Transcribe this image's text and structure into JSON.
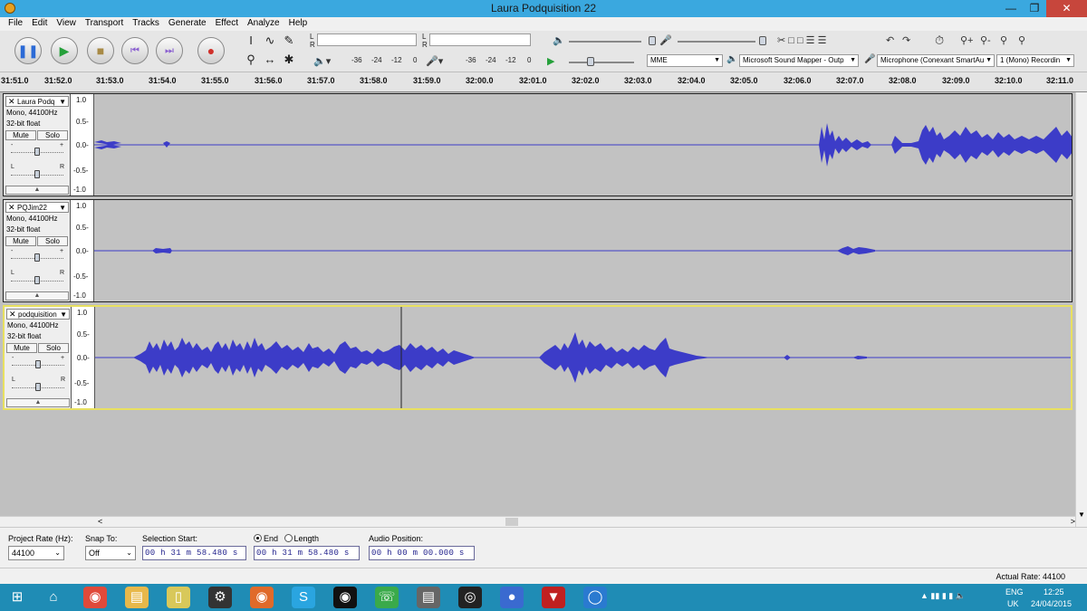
{
  "window": {
    "title": "Laura Podquisition 22"
  },
  "menu": [
    "File",
    "Edit",
    "View",
    "Transport",
    "Tracks",
    "Generate",
    "Effect",
    "Analyze",
    "Help"
  ],
  "meters": {
    "rec_scale": [
      "-36",
      "-24",
      "-12",
      "0"
    ],
    "play_scale": [
      "-36",
      "-24",
      "-12",
      "0"
    ],
    "lr": [
      "L",
      "R"
    ]
  },
  "devices": {
    "host": "MME",
    "output": "Microsoft Sound Mapper - Outp",
    "input": "Microphone (Conexant SmartAu",
    "channels": "1 (Mono) Recordin"
  },
  "ruler_ticks": [
    "31:51.0",
    "31:52.0",
    "31:53.0",
    "31:54.0",
    "31:55.0",
    "31:56.0",
    "31:57.0",
    "31:58.0",
    "31:59.0",
    "32:00.0",
    "32:01.0",
    "32:02.0",
    "32:03.0",
    "32:04.0",
    "32:05.0",
    "32:06.0",
    "32:07.0",
    "32:08.0",
    "32:09.0",
    "32:10.0",
    "32:11.0"
  ],
  "tracks": [
    {
      "name": "Laura Podq",
      "format": "Mono, 44100Hz",
      "depth": "32-bit float",
      "mute": "Mute",
      "solo": "Solo",
      "scale": [
        "1.0",
        "0.5-",
        "0.0-",
        "-0.5-",
        "-1.0"
      ],
      "gain_minus": "-",
      "gain_plus": "+",
      "pan_l": "L",
      "pan_r": "R"
    },
    {
      "name": "PQJim22",
      "format": "Mono, 44100Hz",
      "depth": "32-bit float",
      "mute": "Mute",
      "solo": "Solo",
      "scale": [
        "1.0",
        "0.5-",
        "0.0-",
        "-0.5-",
        "-1.0"
      ],
      "gain_minus": "-",
      "gain_plus": "+",
      "pan_l": "L",
      "pan_r": "R"
    },
    {
      "name": "podquisition",
      "format": "Mono, 44100Hz",
      "depth": "32-bit float",
      "mute": "Mute",
      "solo": "Solo",
      "scale": [
        "1.0",
        "0.5-",
        "0.0-",
        "-0.5-",
        "-1.0"
      ],
      "gain_minus": "-",
      "gain_plus": "+",
      "pan_l": "L",
      "pan_r": "R"
    }
  ],
  "selection": {
    "project_rate_label": "Project Rate (Hz):",
    "project_rate": "44100",
    "snap_label": "Snap To:",
    "snap": "Off",
    "start_label": "Selection Start:",
    "start": "00 h 31 m 58.480 s",
    "end_label": "End",
    "length_label": "Length",
    "end": "00 h 31 m 58.480 s",
    "audio_pos_label": "Audio Position:",
    "audio_pos": "00 h 00 m 00.000 s"
  },
  "status": {
    "actual_rate": "Actual Rate: 44100"
  },
  "taskbar": {
    "lang": "ENG",
    "region": "UK",
    "time": "12:25",
    "date": "24/04/2015"
  },
  "colors": {
    "wave": "#3c3cc8",
    "titlebar": "#3aa8df",
    "taskbar": "#1f8cb5",
    "selected_border": "#e8e060"
  }
}
